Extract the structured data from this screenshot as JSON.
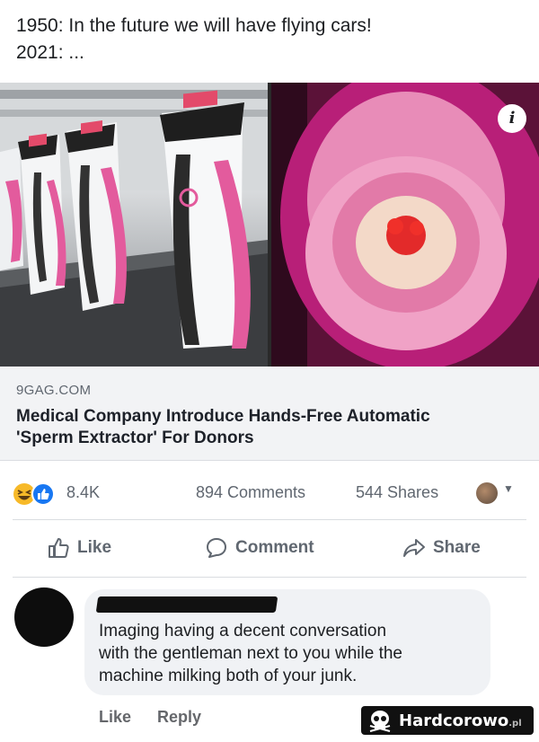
{
  "post": {
    "line1": "1950: In the future we will have flying cars!",
    "line2": "2021: ..."
  },
  "media": {
    "left_photo": "machine-photo",
    "right_photo": "closeup-photo",
    "info_label": "i"
  },
  "link": {
    "domain": "9GAG.COM",
    "title_line1": "Medical Company Introduce Hands-Free Automatic",
    "title_line2": "'Sperm Extractor' For Donors"
  },
  "stats": {
    "reactions": "8.4K",
    "comments": "894 Comments",
    "shares": "544 Shares",
    "reaction_icons": [
      "haha-icon",
      "like-icon"
    ]
  },
  "actions": {
    "like": "Like",
    "comment": "Comment",
    "share": "Share"
  },
  "comment": {
    "line1": "Imaging having a decent conversation",
    "line2": "with the gentleman next to you while the",
    "line3": "machine milking both of your junk.",
    "like": "Like",
    "reply": "Reply"
  },
  "watermark": {
    "text": "Hardcorowo",
    "suffix": ".pl"
  },
  "colors": {
    "accent_blue": "#1877f2",
    "haha_yellow": "#f7b928",
    "machine_pink": "#e0559a"
  }
}
